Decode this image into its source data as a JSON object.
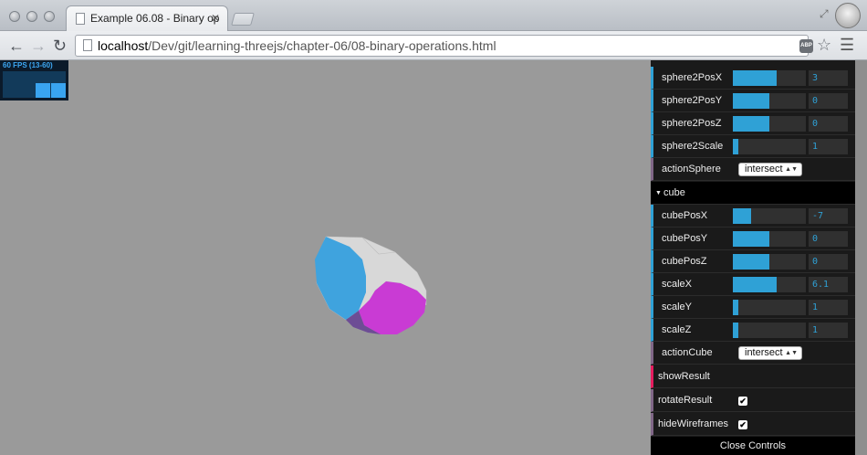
{
  "browser": {
    "tab_title": "Example 06.08 - Binary op",
    "tab_close": "✕",
    "url_host": "localhost",
    "url_path": "/Dev/git/learning-threejs/chapter-06/08-binary-operations.html",
    "abp_label": "ABP"
  },
  "stats": {
    "text": "60 FPS (13-60)"
  },
  "gui": {
    "sphere_rows": [
      {
        "label": "sphere2PosX",
        "value": "3",
        "fill": 0.6
      },
      {
        "label": "sphere2PosY",
        "value": "0",
        "fill": 0.5
      },
      {
        "label": "sphere2PosZ",
        "value": "0",
        "fill": 0.5
      },
      {
        "label": "sphere2Scale",
        "value": "1",
        "fill": 0.08
      }
    ],
    "action_sphere": {
      "label": "actionSphere",
      "selected": "intersect"
    },
    "cube_folder": "cube",
    "cube_rows": [
      {
        "label": "cubePosX",
        "value": "-7",
        "fill": 0.25
      },
      {
        "label": "cubePosY",
        "value": "0",
        "fill": 0.5
      },
      {
        "label": "cubePosZ",
        "value": "0",
        "fill": 0.5
      },
      {
        "label": "scaleX",
        "value": "6.1",
        "fill": 0.6
      },
      {
        "label": "scaleY",
        "value": "1",
        "fill": 0.08
      },
      {
        "label": "scaleZ",
        "value": "1",
        "fill": 0.08
      }
    ],
    "action_cube": {
      "label": "actionCube",
      "selected": "intersect"
    },
    "show_result": "showResult",
    "rotate_result": {
      "label": "rotateResult",
      "checked": "✔"
    },
    "hide_wireframes": {
      "label": "hideWireframes",
      "checked": "✔"
    },
    "close_controls": "Close Controls"
  },
  "colors": {
    "number_accent": "#2fa1d6",
    "mesh_blue": "#3fa3de",
    "mesh_magenta": "#c93bd4",
    "mesh_grey": "#d6d6d6",
    "background": "#9a9a9a"
  }
}
